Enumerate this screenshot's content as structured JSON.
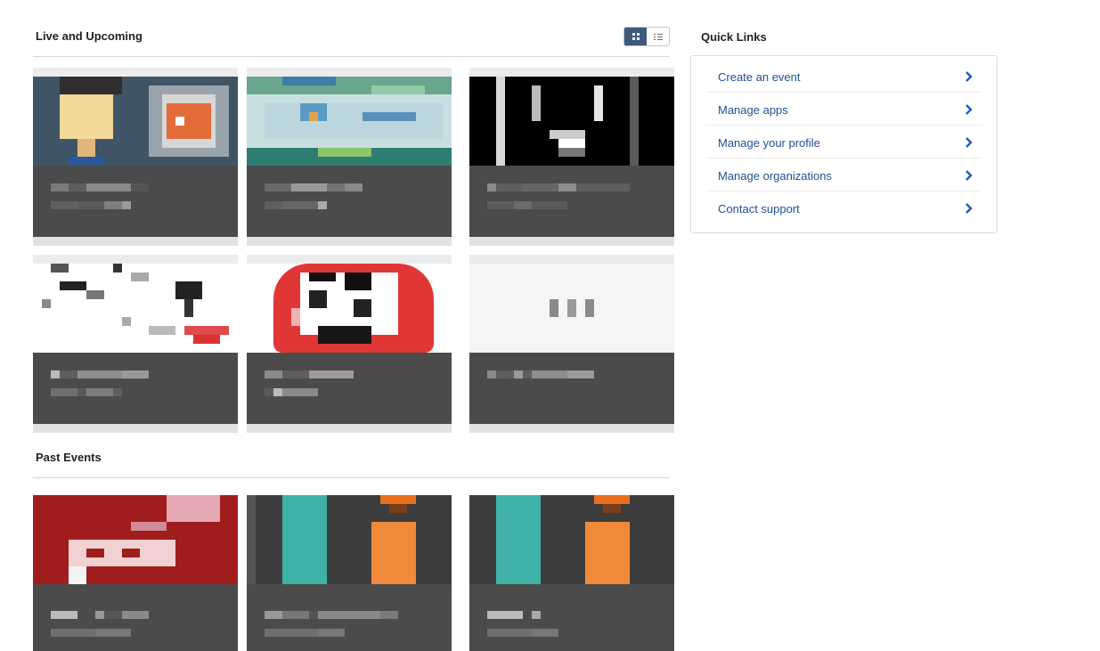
{
  "live_section": {
    "title": "Live and Upcoming",
    "view_toggle": [
      "grid-view-icon",
      "list-view-icon"
    ]
  },
  "past_section": {
    "title": "Past Events"
  },
  "quick_links": {
    "title": "Quick Links",
    "items": [
      {
        "label": "Create an event",
        "icon": "chevron-right-icon"
      },
      {
        "label": "Manage apps",
        "icon": "chevron-right-icon"
      },
      {
        "label": "Manage your profile",
        "icon": "chevron-right-icon"
      },
      {
        "label": "Manage organizations",
        "icon": "chevron-right-icon"
      },
      {
        "label": "Contact support",
        "icon": "chevron-right-icon"
      }
    ]
  },
  "colors": {
    "link": "#1f4f96",
    "chevron": "#1a5cc4",
    "toggle_active": "#3d5a7c",
    "card_info_bg": "#4b4b4b"
  }
}
